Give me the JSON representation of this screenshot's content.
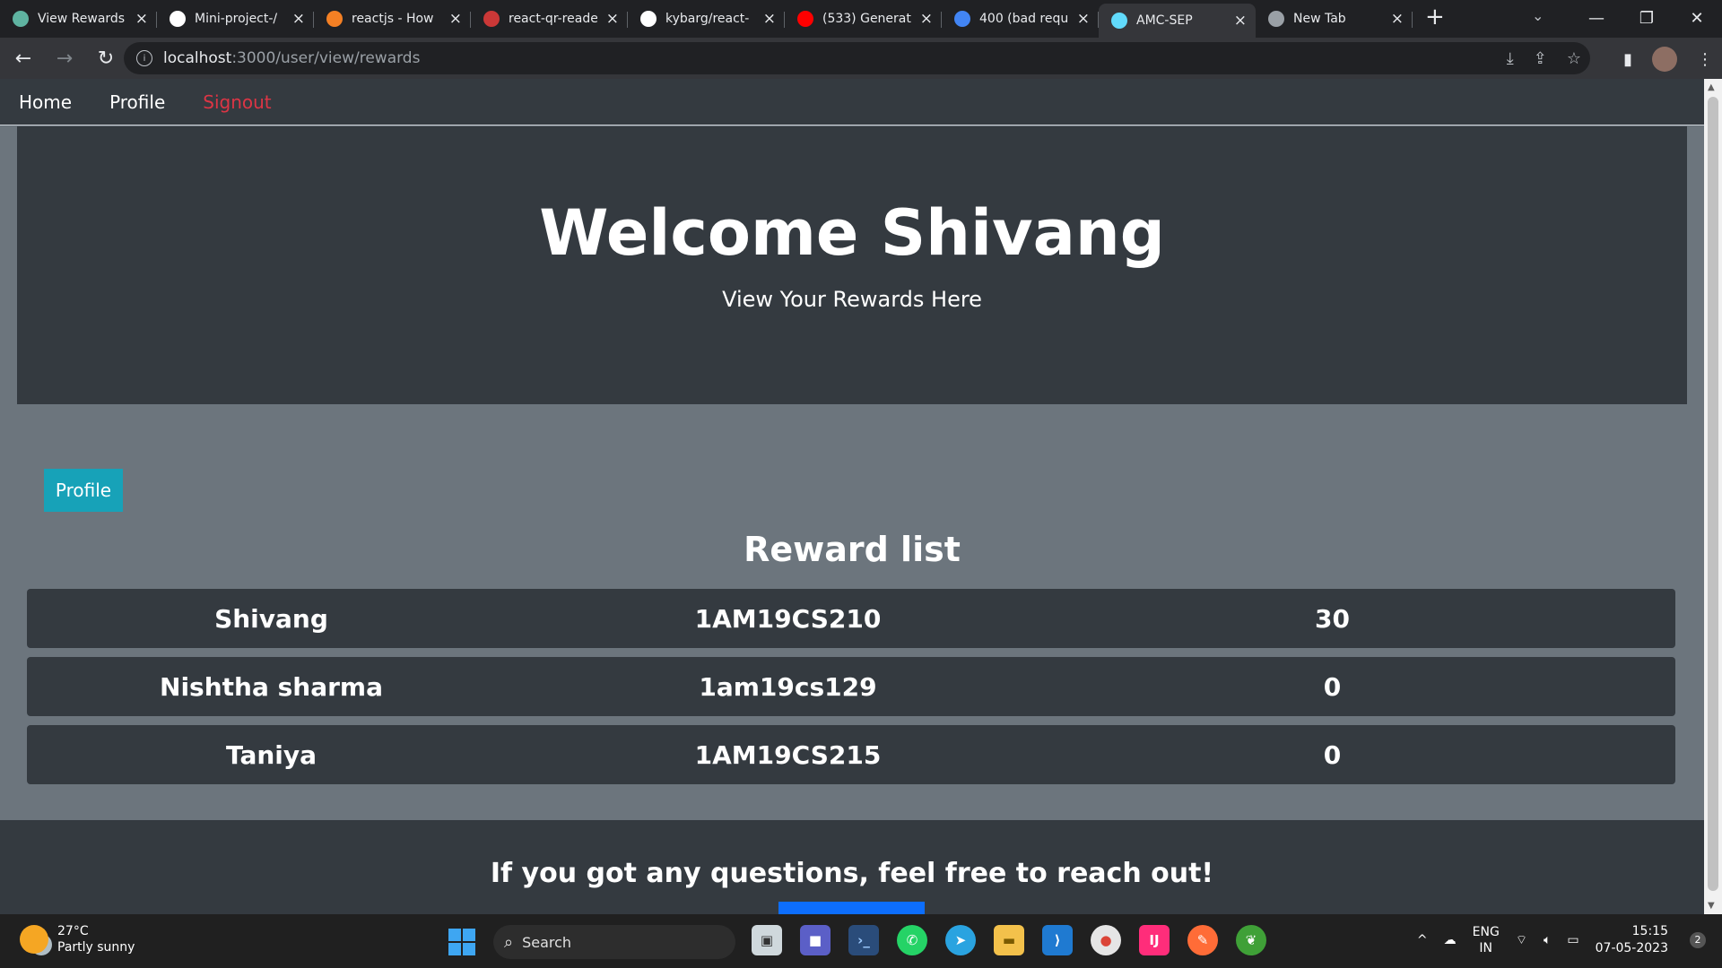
{
  "browser": {
    "tabs": [
      {
        "title": "View Rewards",
        "icon": "app-icon",
        "color": "#5fb3a1"
      },
      {
        "title": "Mini-project-/",
        "icon": "github-icon",
        "color": "#ffffff"
      },
      {
        "title": "reactjs - How",
        "icon": "stackoverflow-icon",
        "color": "#f48024"
      },
      {
        "title": "react-qr-reade",
        "icon": "npm-icon",
        "color": "#cb3837"
      },
      {
        "title": "kybarg/react-",
        "icon": "github-icon",
        "color": "#ffffff"
      },
      {
        "title": "(533) Generat",
        "icon": "youtube-icon",
        "color": "#ff0000"
      },
      {
        "title": "400 (bad requ",
        "icon": "google-icon",
        "color": "#4285f4"
      },
      {
        "title": "AMC-SEP",
        "icon": "react-icon",
        "color": "#61dafb",
        "active": true
      },
      {
        "title": "New Tab",
        "icon": "chrome-icon",
        "color": "#9aa0a6"
      }
    ],
    "url_host": "localhost",
    "url_path": ":3000/user/view/rewards"
  },
  "nav": {
    "home": "Home",
    "profile": "Profile",
    "signout": "Signout"
  },
  "hero": {
    "title": "Welcome Shivang",
    "subtitle": "View Your Rewards Here"
  },
  "profile_button": "Profile",
  "reward_list": {
    "title": "Reward list",
    "rows": [
      {
        "name": "Shivang",
        "usn": "1AM19CS210",
        "points": "30"
      },
      {
        "name": "Nishtha sharma",
        "usn": "1am19cs129",
        "points": "0"
      },
      {
        "name": "Taniya",
        "usn": "1AM19CS215",
        "points": "0"
      }
    ]
  },
  "footer": {
    "text": "If you got any questions, feel free to reach out!"
  },
  "taskbar": {
    "weather_temp": "27°C",
    "weather_desc": "Partly sunny",
    "search_label": "Search",
    "lang_top": "ENG",
    "lang_bottom": "IN",
    "time": "15:15",
    "date": "07-05-2023",
    "notifications": "2"
  },
  "colors": {
    "dark": "#343a40",
    "page_bg": "#6c757d",
    "signout": "#dc3545",
    "profile_button": "#17a2b8",
    "footer_bar": "#0d6efd"
  }
}
